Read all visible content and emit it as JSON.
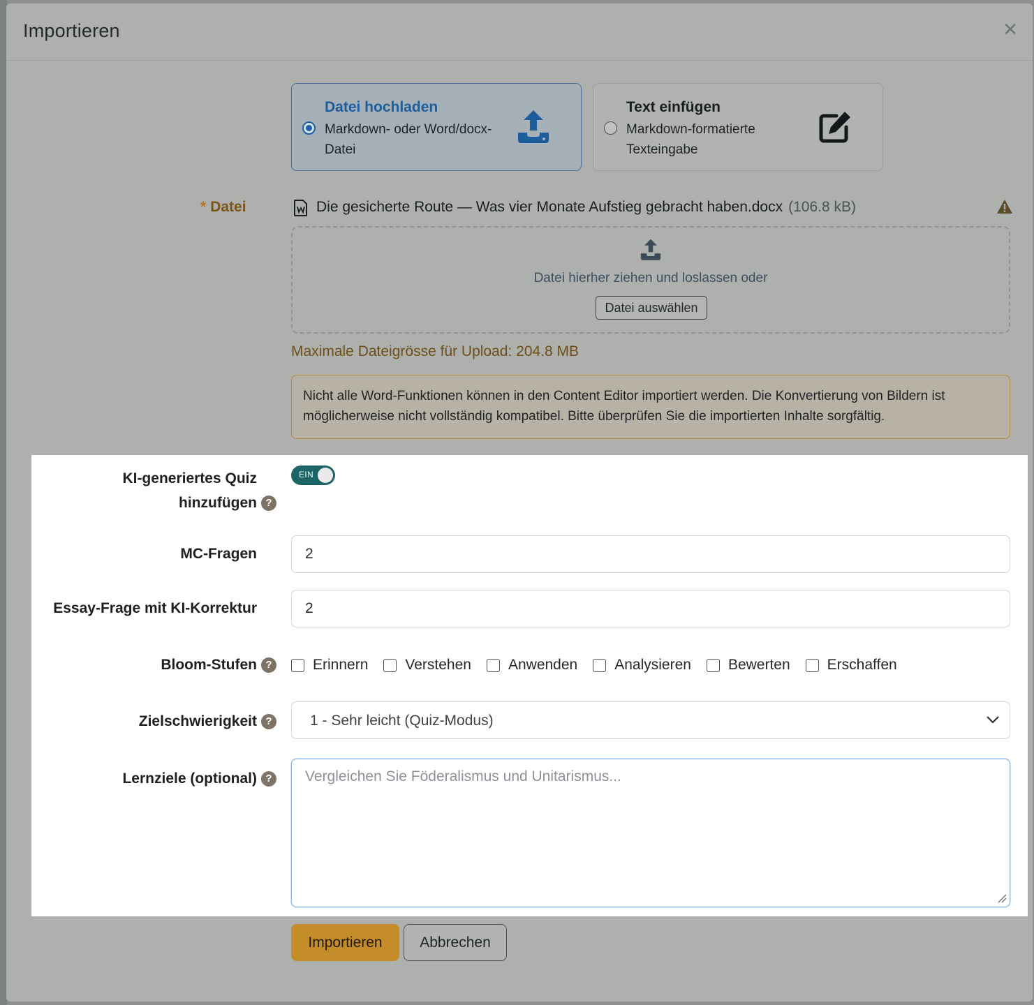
{
  "modal": {
    "title": "Importieren",
    "close_symbol": "×"
  },
  "source_options": [
    {
      "title": "Datei hochladen",
      "description": "Markdown- oder Word/docx-Datei",
      "selected": true,
      "icon": "upload-icon"
    },
    {
      "title": "Text einfügen",
      "description": "Markdown-formatierte Texteingabe",
      "selected": false,
      "icon": "edit-icon"
    }
  ],
  "file": {
    "label": "Datei",
    "required_marker": "*",
    "name": "Die gesicherte Route — Was vier Monate Aufstieg gebracht haben.docx",
    "size": "(106.8 kB)",
    "dropzone_text": "Datei hierher ziehen und loslassen oder",
    "choose_button": "Datei auswählen",
    "max_size": "Maximale Dateigrösse für Upload: 204.8 MB"
  },
  "notice": "Nicht alle Word-Funktionen können in den Content Editor importiert werden. Die Konvertierung von Bildern ist möglicherweise nicht vollständig kompatibel. Bitte überprüfen Sie die importierten Inhalte sorgfältig.",
  "quiz": {
    "label_line1": "KI-generiertes Quiz",
    "label_line2": "hinzufügen",
    "toggle_text": "EIN",
    "enabled": true
  },
  "mc_questions": {
    "label": "MC-Fragen",
    "value": "2"
  },
  "essay_questions": {
    "label": "Essay-Frage mit KI-Korrektur",
    "value": "2"
  },
  "bloom": {
    "label": "Bloom-Stufen",
    "options": [
      "Erinnern",
      "Verstehen",
      "Anwenden",
      "Analysieren",
      "Bewerten",
      "Erschaffen"
    ]
  },
  "difficulty": {
    "label": "Zielschwierigkeit",
    "value": "1 - Sehr leicht (Quiz-Modus)"
  },
  "objectives": {
    "label": "Lernziele (optional)",
    "placeholder": "Vergleichen Sie Föderalismus und Unitarismus..."
  },
  "help_symbol": "?",
  "actions": {
    "import": "Importieren",
    "cancel": "Abbrechen"
  },
  "colors": {
    "accent_blue": "#1e5d9b",
    "toggle_teal": "#1c6466",
    "primary_button": "#c58c2a",
    "warning_border": "#b58a3c"
  }
}
